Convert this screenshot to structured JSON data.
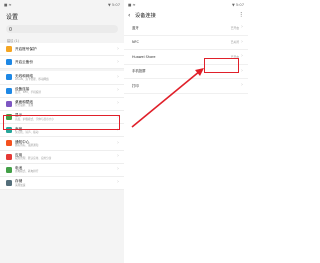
{
  "left": {
    "status_left": "■ ≋",
    "status_right": "▼ 5:07",
    "title": "设置",
    "suggestions_label": "建议 (1)",
    "items": [
      {
        "label": "开启账号保护",
        "sub": "",
        "color": "#f5a623"
      },
      {
        "label": "开启云备份",
        "sub": "",
        "color": "#1e88e5"
      },
      {
        "label": "无线和网络",
        "sub": "WLAN、双卡管理、移动网络",
        "color": "#1e88e5"
      },
      {
        "label": "设备连接",
        "sub": "蓝牙、NFC、手机投屏",
        "color": "#1e88e5"
      },
      {
        "label": "桌面和壁纸",
        "sub": "杂志锁屏、主题",
        "color": "#7e57c2"
      },
      {
        "label": "显示",
        "sub": "亮度、护眼模式、字体与显示大小",
        "color": "#43a047"
      },
      {
        "label": "声音",
        "sub": "免打扰、铃声、振动",
        "color": "#26a69a"
      },
      {
        "label": "通知中心",
        "sub": "图标角标、锁屏通知",
        "color": "#f4511e"
      },
      {
        "label": "应用",
        "sub": "权限管理、默认应用、应用分身",
        "color": "#e53935"
      },
      {
        "label": "电池",
        "sub": "省电模式、耗电排行",
        "color": "#43a047"
      },
      {
        "label": "存储",
        "sub": "清理加速",
        "color": "#546e7a"
      }
    ]
  },
  "right": {
    "status_left": "■ ≋",
    "status_right": "▼ 5:07",
    "back": "‹",
    "title": "设备连接",
    "more": "⋮",
    "items": [
      {
        "label": "蓝牙",
        "status": "已开启"
      },
      {
        "label": "NFC",
        "status": "已关闭"
      },
      {
        "label": "Huawei Share",
        "status": "已开启"
      },
      {
        "label": "手机投屏",
        "status": ""
      },
      {
        "label": "打印",
        "status": ""
      }
    ]
  },
  "colors": {
    "highlight": "#e0202a"
  }
}
